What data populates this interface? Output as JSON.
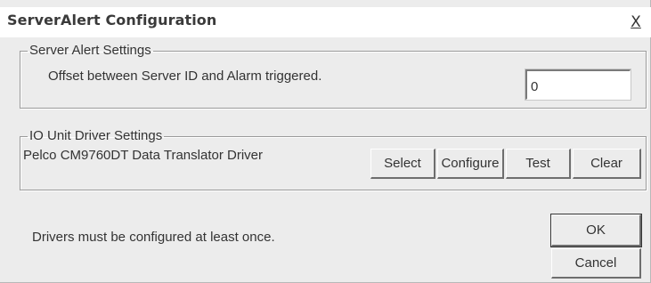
{
  "window": {
    "title": "ServerAlert Configuration",
    "close_glyph": "X"
  },
  "server_alert": {
    "legend": "Server Alert Settings",
    "offset_label": "Offset between Server ID and Alarm triggered.",
    "offset_value": "0"
  },
  "io_unit": {
    "legend": "IO Unit Driver Settings",
    "driver_name": "Pelco CM9760DT Data Translator Driver",
    "buttons": {
      "select": "Select",
      "configure": "Configure",
      "test": "Test",
      "clear": "Clear"
    }
  },
  "footer": {
    "note": "Drivers must be configured at least once.",
    "ok": "OK",
    "cancel": "Cancel"
  }
}
